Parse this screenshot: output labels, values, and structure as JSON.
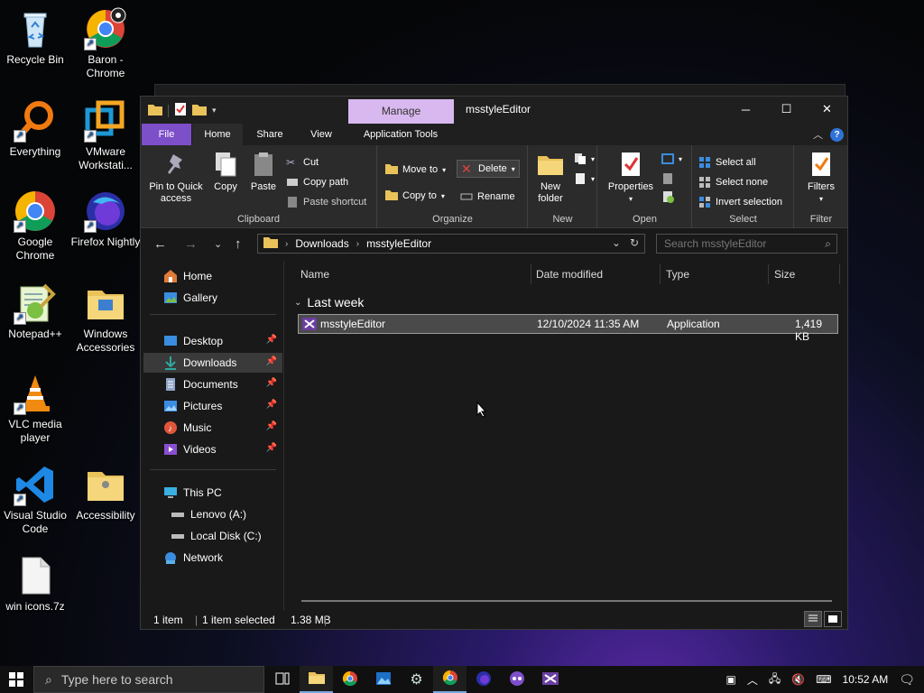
{
  "desktop": {
    "icons": [
      {
        "label": "Recycle Bin"
      },
      {
        "label": "Baron - Chrome"
      },
      {
        "label": "Everything"
      },
      {
        "label": "VMware Workstati..."
      },
      {
        "label": "Google Chrome"
      },
      {
        "label": "Firefox Nightly"
      },
      {
        "label": "Notepad++"
      },
      {
        "label": "Windows Accessories"
      },
      {
        "label": "VLC media player"
      },
      {
        "label": "Visual Studio Code"
      },
      {
        "label": "Accessibility"
      },
      {
        "label": "win icons.7z"
      }
    ]
  },
  "window": {
    "title": "msstyleEditor",
    "contextual_tab": "Manage",
    "tabs": [
      "File",
      "Home",
      "Share",
      "View",
      "Application Tools"
    ],
    "ribbon": {
      "clipboard": {
        "label": "Clipboard",
        "pin": "Pin to Quick access",
        "copy": "Copy",
        "paste": "Paste",
        "cut": "Cut",
        "copy_path": "Copy path",
        "paste_shortcut": "Paste shortcut"
      },
      "organize": {
        "label": "Organize",
        "move_to": "Move to",
        "copy_to": "Copy to",
        "delete": "Delete",
        "rename": "Rename"
      },
      "new": {
        "label": "New",
        "new_folder": "New folder"
      },
      "open": {
        "label": "Open",
        "properties": "Properties"
      },
      "select": {
        "label": "Select",
        "select_all": "Select all",
        "select_none": "Select none",
        "invert": "Invert selection"
      },
      "filter": {
        "label": "Filter",
        "filters": "Filters"
      }
    },
    "address": {
      "crumbs": [
        "Downloads",
        "msstyleEditor"
      ],
      "search_placeholder": "Search msstyleEditor"
    },
    "sidebar": {
      "items": [
        {
          "label": "Home"
        },
        {
          "label": "Gallery"
        },
        {
          "label": "Desktop"
        },
        {
          "label": "Downloads"
        },
        {
          "label": "Documents"
        },
        {
          "label": "Pictures"
        },
        {
          "label": "Music"
        },
        {
          "label": "Videos"
        },
        {
          "label": "This PC"
        },
        {
          "label": "Lenovo (A:)"
        },
        {
          "label": "Local Disk (C:)"
        },
        {
          "label": "Network"
        }
      ]
    },
    "columns": {
      "name": "Name",
      "date": "Date modified",
      "type": "Type",
      "size": "Size"
    },
    "group_heading": "Last week",
    "files": [
      {
        "name": "msstyleEditor",
        "date": "12/10/2024 11:35 AM",
        "type": "Application",
        "size": "1,419 KB"
      }
    ],
    "status": {
      "count": "1 item",
      "selected": "1 item selected",
      "size": "1.38 MB"
    }
  },
  "taskbar": {
    "search_placeholder": "Type here to search",
    "time": "10:52 AM"
  }
}
